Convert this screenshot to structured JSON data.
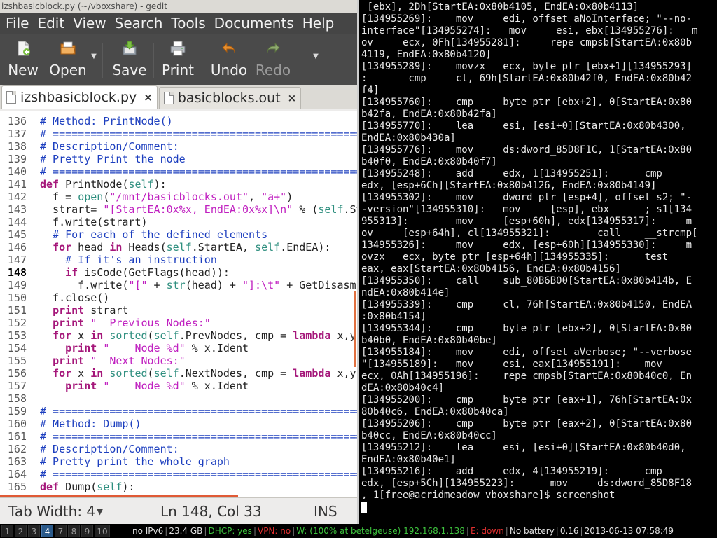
{
  "gedit": {
    "title": "izshbasicblock.py (~/vboxshare) - gedit",
    "menu": [
      "File",
      "Edit",
      "View",
      "Search",
      "Tools",
      "Documents",
      "Help"
    ],
    "toolbar": {
      "new": "New",
      "open": "Open",
      "save": "Save",
      "print": "Print",
      "undo": "Undo",
      "redo": "Redo"
    },
    "tabs": [
      {
        "label": "izshbasicblock.py",
        "close": "×"
      },
      {
        "label": "basicblocks.out",
        "close": "×"
      }
    ],
    "line_numbers": [
      "136",
      "137",
      "138",
      "139",
      "140",
      "141",
      "142",
      "143",
      "144",
      "145",
      "146",
      "147",
      "148",
      "149",
      "150",
      "151",
      "152",
      "153",
      "154",
      "155",
      "156",
      "157",
      "158",
      "159",
      "160",
      "161",
      "162",
      "163",
      "164",
      "165"
    ],
    "current_line": "148",
    "code": [
      "# Method: PrintNode()",
      "# ================================================================",
      "# Description/Comment:",
      "# Pretty Print the node",
      "# ================================================================",
      "def PrintNode(self):",
      "  f = open(\"/mnt/basicblocks.out\", \"a+\")",
      "  strart= \"[StartEA:0x%x, EndEA:0x%x]\\n\" % (self.StartEA, self.EndEA)",
      "  f.write(strart)",
      "  # For each of the defined elements",
      "  for head in Heads(self.StartEA, self.EndEA):",
      "    # If it's an instruction",
      "    if isCode(GetFlags(head)):",
      "      f.write(\"[\" + str(head) + \"]:\\t\" + GetDisasm(head))",
      "  f.close()",
      "  print strart",
      "  print \"  Previous Nodes:\"",
      "  for x in sorted(self.PrevNodes, cmp = lambda x,y: x.Ident - y.Ident):",
      "    print \"    Node %d\" % x.Ident",
      "  print \"  Next Nodes:\"",
      "  for x in sorted(self.NextNodes, cmp = lambda x,y: x.Ident - y.Ident):",
      "    print \"    Node %d\" % x.Ident",
      "",
      "# ================================================================",
      "# Method: Dump()",
      "# ================================================================",
      "# Description/Comment:",
      "# Pretty print the whole graph",
      "# ================================================================",
      "def Dump(self):"
    ],
    "statusbar": {
      "tab_width": "Tab Width:  4",
      "position": "Ln 148, Col 33",
      "mode": "INS"
    }
  },
  "terminal": {
    "lines": [
      " [ebx], 2Dh[StartEA:0x80b4105, EndEA:0x80b4113]",
      "[134955269]:    mov     edi, offset aNoInterface; \"--no-",
      "interface\"[134955274]:   mov     esi, ebx[134955276]:   m",
      "ov     ecx, 0Fh[134955281]:     repe cmpsb[StartEA:0x80b",
      "4119, EndEA:0x80b4120]",
      "[134955289]:    movzx   ecx, byte ptr [ebx+1][134955293]",
      ":       cmp     cl, 69h[StartEA:0x80b42f0, EndEA:0x80b42",
      "f4]",
      "[134955760]:    cmp     byte ptr [ebx+2], 0[StartEA:0x80",
      "b42fa, EndEA:0x80b42fa]",
      "[134955770]:    lea     esi, [esi+0][StartEA:0x80b4300,",
      "EndEA:0x80b430a]",
      "[134955776]:    mov     ds:dword_85D8F1C, 1[StartEA:0x80",
      "b40f0, EndEA:0x80b40f7]",
      "[134955248]:    add     edx, 1[134955251]:      cmp",
      "edx, [esp+6Ch][StartEA:0x80b4126, EndEA:0x80b4149]",
      "[134955302]:    mov     dword ptr [esp+4], offset s2; \"-",
      "-version\"[134955310]:   mov     [esp], ebx      ; s1[134",
      "955313]:        mov     [esp+60h], edx[134955317]:     m",
      "ov     [esp+64h], cl[134955321]:        call    __strcmp[",
      "134955326]:     mov     edx, [esp+60h][134955330]:     m",
      "ovzx   ecx, byte ptr [esp+64h][134955335]:      test",
      "eax, eax[StartEA:0x80b4156, EndEA:0x80b4156]",
      "[134955350]:    call    sub_80B6B00[StartEA:0x80b414b, E",
      "ndEA:0x80b414e]",
      "[134955339]:    cmp     cl, 76h[StartEA:0x80b4150, EndEA",
      ":0x80b4154]",
      "[134955344]:    cmp     byte ptr [ebx+2], 0[StartEA:0x80",
      "b40b0, EndEA:0x80b40be]",
      "[134955184]:    mov     edi, offset aVerbose; \"--verbose",
      "\"[134955189]:   mov     esi, eax[134955191]:    mov",
      "ecx, 0Ah[134955196]:    repe cmpsb[StartEA:0x80b40c0, En",
      "dEA:0x80b40c4]",
      "[134955200]:    cmp     byte ptr [eax+1], 76h[StartEA:0x",
      "80b40c6, EndEA:0x80b40ca]",
      "[134955206]:    cmp     byte ptr [eax+2], 0[StartEA:0x80",
      "b40cc, EndEA:0x80b40cc]",
      "[134955212]:    lea     esi, [esi+0][StartEA:0x80b40d0,",
      "EndEA:0x80b40e1]",
      "[134955216]:    add     edx, 4[134955219]:      cmp",
      "edx, [esp+5Ch][134955223]:      mov     ds:dword_85D8F18",
      ", 1[free@acridmeadow vboxshare]$ screenshot"
    ]
  },
  "wmbar": {
    "workspaces": [
      "1",
      "2",
      "3",
      "4",
      "7",
      "8",
      "9",
      "10"
    ],
    "active_workspace": "4",
    "ipv6": "no IPv6",
    "disk": "23.4 GB",
    "dhcp": "DHCP: yes",
    "vpn": "VPN: no",
    "wifi": "W: (100% at betelgeuse) 192.168.1.138",
    "eth": "E: down",
    "battery": "No battery",
    "load": "0.16",
    "datetime": "2013-06-13 07:58:49"
  },
  "colors": {
    "comment": "#1d3fbf",
    "keyword": "#a5177a",
    "string": "#c020c0",
    "builtin": "#2f8f7f",
    "status_green": "#3ec43e",
    "status_red": "#e23030",
    "active_workspace": "#2b5a8a"
  }
}
